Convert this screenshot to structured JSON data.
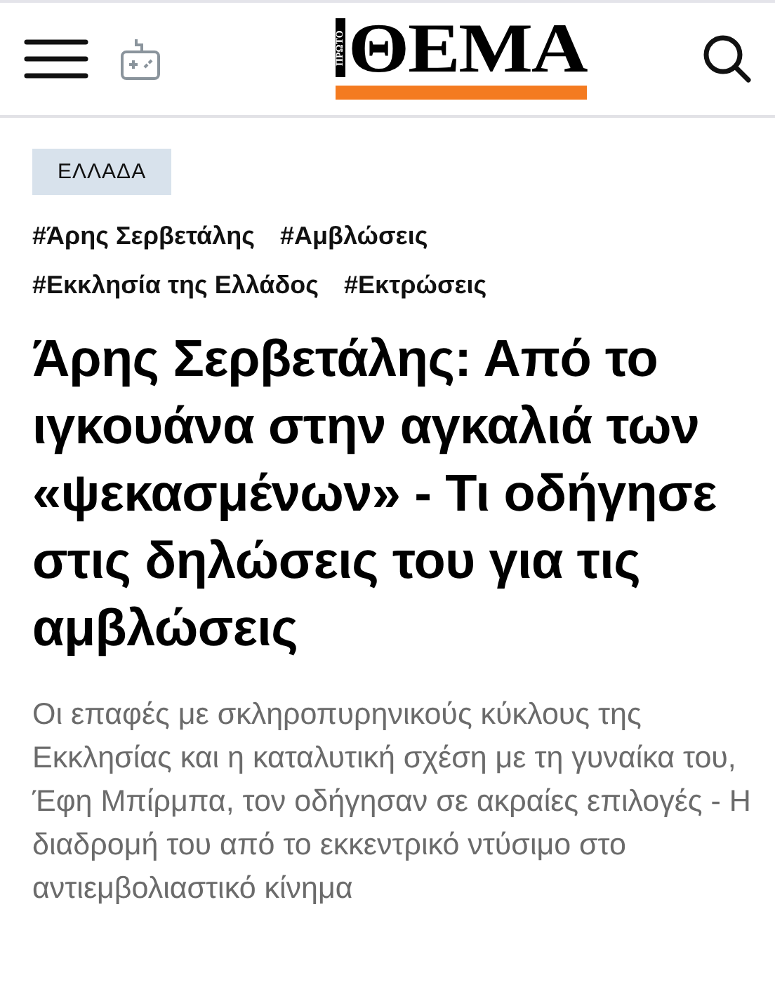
{
  "header": {
    "logo": {
      "small": "ΠΡΩΤΟ",
      "main": "ΘΕΜΑ"
    }
  },
  "category": "ΕΛΛΑΔΑ",
  "tags": [
    "#Άρης Σερβετάλης",
    "#Αμβλώσεις",
    "#Εκκλησία της Ελλάδος",
    "#Εκτρώσεις"
  ],
  "headline": "Άρης Σερβετάλης: Από το ιγκουάνα στην αγκαλιά των «ψεκασμένων» - Τι οδήγησε στις δηλώσεις του για τις αμβλώσεις",
  "summary": "Οι επαφές με σκληροπυρηνικούς κύκλους της Εκκλησίας και η καταλυτική σχέση με τη γυναίκα του, Έφη Μπίρμπα, τον οδήγησαν σε ακραίες επιλογές - Η διαδρομή του από το εκκεντρικό ντύσιμο στο αντιεμβολιαστικό κίνημα"
}
